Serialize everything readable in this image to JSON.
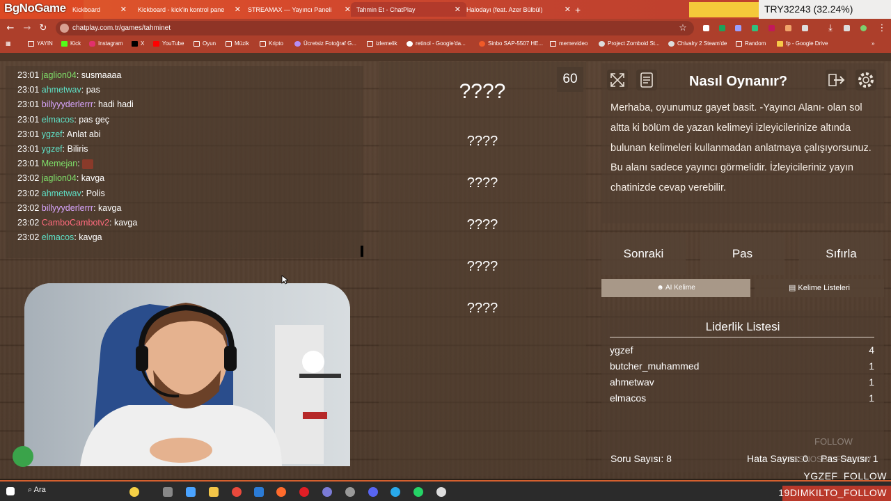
{
  "browser": {
    "tabs": [
      {
        "label": "Kickboard"
      },
      {
        "label": "Kickboard - kick'in kontrol pane"
      },
      {
        "label": "STREAMAX — Yayıncı Paneli"
      },
      {
        "label": "Tahmin Et - ChatPlay"
      },
      {
        "label": "Halodayı (feat. Azer Bülbül)"
      }
    ],
    "new_tab": "+",
    "url": "chatplay.com.tr/games/tahminet",
    "bookmarks": [
      "YAYIN",
      "Kick",
      "Instagram",
      "X",
      "YouTube",
      "Oyun",
      "Müzik",
      "Kripto",
      "Ücretsiz Fotoğraf G...",
      "izlemelik",
      "retinol - Google'da...",
      "Sinbo SAP-5507 HE...",
      "memevideo",
      "Project Zomboid St...",
      "Chivalry 2 Steam'de",
      "Random",
      "fp - Google Drive"
    ]
  },
  "overlay": {
    "brand": "BgNoGame",
    "counter": "TRY32243 (32.24%)",
    "follow_1": "YGZEF_FOLLOW",
    "follow_2": "19DIMKILTO_FOLLOW",
    "ghost_1": "FOLLOW",
    "ghost_2": "PASSNOSSE FOLLOW"
  },
  "chat": [
    {
      "time": "23:01",
      "user": "jaglion04",
      "msg": "susmaaaa",
      "color": "#7fe06a"
    },
    {
      "time": "23:01",
      "user": "ahmetwav",
      "msg": "pas",
      "color": "#5ee0c6"
    },
    {
      "time": "23:01",
      "user": "billyyyderlerrr",
      "msg": "hadi hadi",
      "color": "#d9a6ff"
    },
    {
      "time": "23:01",
      "user": "elmacos",
      "msg": "pas geç",
      "color": "#5ee0c6"
    },
    {
      "time": "23:01",
      "user": "ygzef",
      "msg": "Anlat abi",
      "color": "#5ee0c6"
    },
    {
      "time": "23:01",
      "user": "ygzef",
      "msg": "Biliris",
      "color": "#5ee0c6"
    },
    {
      "time": "23:01",
      "user": "Memejan",
      "msg": "",
      "color": "#7fe06a"
    },
    {
      "time": "23:02",
      "user": "jaglion04",
      "msg": "kavga",
      "color": "#7fe06a"
    },
    {
      "time": "23:02",
      "user": "ahmetwav",
      "msg": "Polis",
      "color": "#5ee0c6"
    },
    {
      "time": "23:02",
      "user": "billyyyderlerrr",
      "msg": "kavga",
      "color": "#d9a6ff"
    },
    {
      "time": "23:02",
      "user": "CamboCambotv2",
      "msg": "kavga",
      "color": "#ff6b7d"
    },
    {
      "time": "23:02",
      "user": "elmacos",
      "msg": "kavga",
      "color": "#5ee0c6"
    }
  ],
  "game": {
    "timer": "60",
    "main_word": "????",
    "forbidden": [
      "????",
      "????",
      "????",
      "????",
      "????"
    ]
  },
  "howto": {
    "title": "Nasıl Oynanır?",
    "text": "Merhaba, oyunumuz gayet basit. -Yayıncı Alanı- olan sol altta ki bölüm de yazan kelimeyi izleyicilerinize altında bulunan kelimeleri kullanmadan anlatmaya çalışıyorsunuz. Bu alanı sadece yayıncı görmelidir. İzleyicileriniz yayın chatinizde cevap verebilir."
  },
  "actions": {
    "next": "Sonraki",
    "pass": "Pas",
    "reset": "Sıfırla",
    "ai_word": "AI Kelime",
    "word_lists": "Kelime Listeleri"
  },
  "leaderboard": {
    "title": "Liderlik Listesi",
    "rows": [
      {
        "name": "ygzef",
        "score": "4"
      },
      {
        "name": "butcher_muhammed",
        "score": "1"
      },
      {
        "name": "ahmetwav",
        "score": "1"
      },
      {
        "name": "elmacos",
        "score": "1"
      }
    ],
    "question_count": "Soru Sayısı: 8",
    "error_count": "Hata Sayısı: 0",
    "pass_count": "Pas Sayısı: 1"
  },
  "taskbar": {
    "search": "Ara"
  }
}
